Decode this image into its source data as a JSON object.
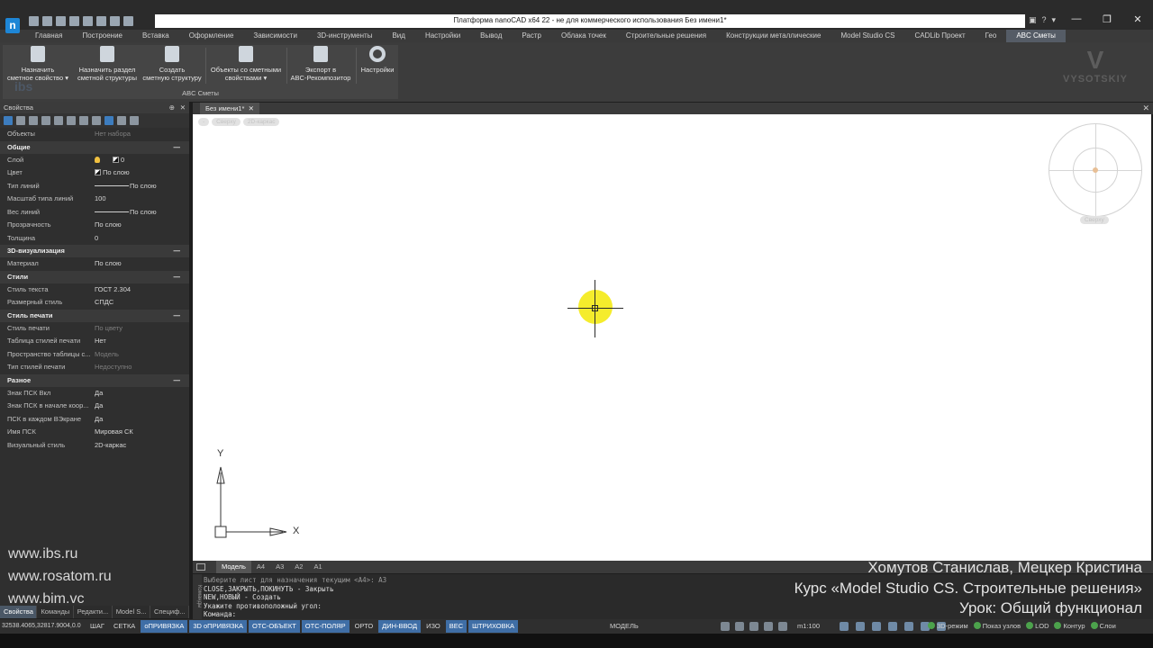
{
  "window": {
    "title": "Платформа nanoCAD x64 22 - не для коммерческого использования Без имени1*",
    "logo_letter": "n",
    "help": "?",
    "controls": {
      "minimize": "—",
      "maximize": "❐",
      "close": "✕"
    }
  },
  "ribbon_tabs": [
    "Главная",
    "Построение",
    "Вставка",
    "Оформление",
    "Зависимости",
    "3D-инструменты",
    "Вид",
    "Настройки",
    "Вывод",
    "Растр",
    "Облака точек",
    "Строительные решения",
    "Конструкции металлические",
    "Model Studio CS",
    "CADLib Проект",
    "Гео",
    "ABC Сметы"
  ],
  "active_tab": "ABC Сметы",
  "ribbon": {
    "group_label": "ABC Сметы",
    "buttons": [
      {
        "label1": "Назначить",
        "label2": "сметное свойство ▾"
      },
      {
        "label1": "Назначить раздел",
        "label2": "сметной структуры"
      },
      {
        "label1": "Создать",
        "label2": "сметную структуру"
      },
      {
        "label1": "Объекты со сметными",
        "label2": "свойствами ▾"
      },
      {
        "label1": "Экспорт в",
        "label2": "ABC-Рекомпозитор"
      },
      {
        "label1": "Настройки",
        "label2": ""
      }
    ]
  },
  "watermark": {
    "logo": "V",
    "name": "VYSOTSKIY",
    "ibs": "ibs"
  },
  "properties": {
    "title": "Свойства",
    "objects_label": "Объекты",
    "objects_value": "Нет набора",
    "sections": [
      {
        "title": "Общие",
        "rows": [
          {
            "k": "Слой",
            "v": "0"
          },
          {
            "k": "Цвет",
            "v": "По слою"
          },
          {
            "k": "Тип линий",
            "v": "По слою"
          },
          {
            "k": "Масштаб типа линий",
            "v": "100"
          },
          {
            "k": "Вес линий",
            "v": "По слою"
          },
          {
            "k": "Прозрачность",
            "v": "По слою"
          },
          {
            "k": "Толщина",
            "v": "0"
          }
        ]
      },
      {
        "title": "3D-визуализация",
        "rows": [
          {
            "k": "Материал",
            "v": "По слою"
          }
        ]
      },
      {
        "title": "Стили",
        "rows": [
          {
            "k": "Стиль текста",
            "v": "ГОСТ 2.304"
          },
          {
            "k": "Размерный стиль",
            "v": "СПДС"
          }
        ]
      },
      {
        "title": "Стиль печати",
        "rows": [
          {
            "k": "Стиль печати",
            "v": "По цвету"
          },
          {
            "k": "Таблица стилей печати",
            "v": "Нет"
          },
          {
            "k": "Пространство таблицы с...",
            "v": "Модель"
          },
          {
            "k": "Тип стилей печати",
            "v": "Недоступно"
          }
        ]
      },
      {
        "title": "Разное",
        "rows": [
          {
            "k": "Знак ПСК Вкл",
            "v": "Да"
          },
          {
            "k": "Знак ПСК в начале коор...",
            "v": "Да"
          },
          {
            "k": "ПСК в каждом ВЭкране",
            "v": "Да"
          },
          {
            "k": "Имя ПСК",
            "v": "Мировая СК"
          },
          {
            "k": "Визуальный стиль",
            "v": "2D-каркас"
          }
        ]
      }
    ]
  },
  "left_watermark": [
    "www.ibs.ru",
    "www.rosatom.ru",
    "www.bim.vc"
  ],
  "panel_tabs": [
    "Свойства",
    "Команды",
    "Редакти...",
    "Model S...",
    "Специф..."
  ],
  "document_tab": "Без имени1*",
  "viewport_labels": [
    "-",
    "Сверху",
    "2D-каркас"
  ],
  "compass_label": "Сверху",
  "ucs": {
    "x": "X",
    "y": "Y"
  },
  "layout_tabs": [
    "Модель",
    "A4",
    "A3",
    "A2",
    "A1"
  ],
  "course_watermark": [
    "Хомутов Станислав, Мецкер Кристина",
    "Курс «Model Studio CS. Строительные решения»",
    "Урок: Общий функционал"
  ],
  "command_lines": [
    "Выберите лист для назначения текущим <A4>: A3",
    "CLOSE,ЗАКРЫТЬ,ПОКИНУТЬ - Закрыть",
    "NEW,НОВЫЙ - Создать",
    "Укажите противоположный угол:",
    "Команда:"
  ],
  "command_side_label": "Команды",
  "status": {
    "coords": "32538.4065,32817.9004,0.0",
    "buttons": [
      {
        "label": "ШАГ",
        "on": false
      },
      {
        "label": "СЕТКА",
        "on": false
      },
      {
        "label": "оПРИВЯЗКА",
        "on": true
      },
      {
        "label": "3D оПРИВЯЗКА",
        "on": true
      },
      {
        "label": "ОТС-ОБЪЕКТ",
        "on": true
      },
      {
        "label": "ОТС-ПОЛЯР",
        "on": true
      },
      {
        "label": "ОРТО",
        "on": false
      },
      {
        "label": "ДИН-ВВОД",
        "on": true
      },
      {
        "label": "ИЗО",
        "on": false
      },
      {
        "label": "ВЕС",
        "on": true
      },
      {
        "label": "ШТРИХОВКА",
        "on": true
      }
    ],
    "model": "МОДЕЛЬ",
    "scale": "m1:100",
    "right": [
      "3D-режим",
      "Показ узлов",
      "LOD",
      "Контур",
      "Слои"
    ]
  }
}
